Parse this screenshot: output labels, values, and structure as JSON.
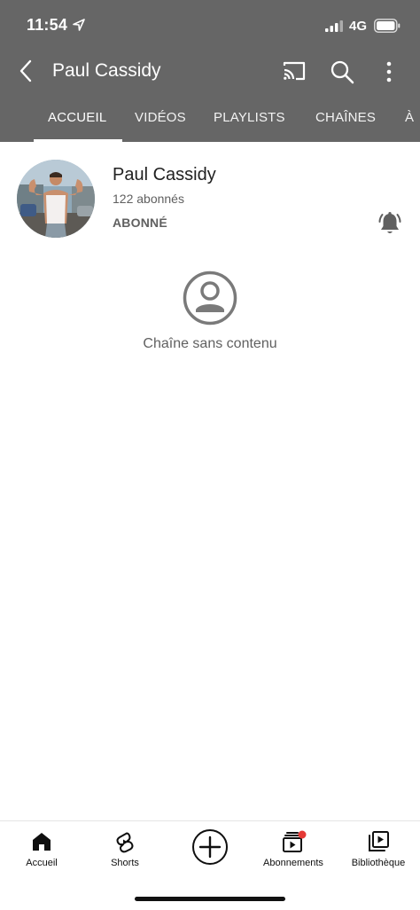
{
  "status_bar": {
    "time": "11:54",
    "network": "4G",
    "icons": [
      "location-arrow-icon",
      "signal-bars-icon",
      "battery-icon"
    ]
  },
  "app_bar": {
    "title": "Paul Cassidy",
    "icons": [
      "back-arrow-icon",
      "cast-icon",
      "search-icon",
      "more-vert-icon"
    ]
  },
  "tabs": [
    {
      "label": "ACCUEIL",
      "active": true
    },
    {
      "label": "VIDÉOS",
      "active": false
    },
    {
      "label": "PLAYLISTS",
      "active": false
    },
    {
      "label": "CHAÎNES",
      "active": false
    },
    {
      "label": "À",
      "active": false
    }
  ],
  "channel": {
    "name": "Paul Cassidy",
    "subscribers": "122 abonnés",
    "subscribed_label": "ABONNÉ",
    "bell_icon": "bell-icon"
  },
  "empty_state": {
    "icon": "account-circle-icon",
    "text": "Chaîne sans contenu"
  },
  "bottom_nav": {
    "items": [
      {
        "label": "Accueil",
        "icon": "home-icon"
      },
      {
        "label": "Shorts",
        "icon": "shorts-icon"
      },
      {
        "label": "",
        "icon": "create-plus-icon"
      },
      {
        "label": "Abonnements",
        "icon": "subscriptions-icon"
      },
      {
        "label": "Bibliothèque",
        "icon": "library-icon"
      }
    ]
  },
  "colors": {
    "header_bg": "#666666",
    "notification_dot": "#e53935",
    "text_primary": "#212121",
    "text_secondary": "#606060"
  }
}
